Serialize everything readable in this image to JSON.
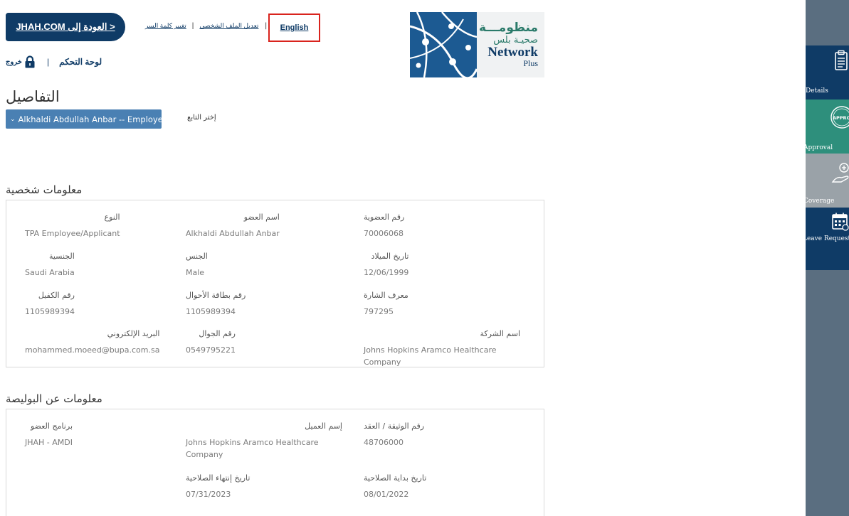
{
  "header": {
    "back_button_label": "< العودة إلى JHAH.COM",
    "change_password_link": "تغيير كلمة السر",
    "edit_profile_link": "تعديل الملف الشخصي",
    "language_link": "English",
    "separator": "|",
    "dashboard_link": "لوحة التحكم",
    "logout_label": "خروج",
    "logo": {
      "arabic_line1": "منظومـــة",
      "arabic_line2": "صحيـة بلس",
      "english_line1": "Network",
      "english_line2": "Plus"
    }
  },
  "page": {
    "title": "التفاصيل",
    "dependent_select_value": "Alkhaldi Abdullah Anbar -- Employee",
    "dependent_label": "إختر التابع"
  },
  "personal_info": {
    "title": "معلومات شخصية",
    "fields": {
      "membership_no": {
        "label": "رقم العضوية",
        "value": "70006068"
      },
      "member_name": {
        "label": "اسم العضو",
        "value": "Alkhaldi Abdullah Anbar"
      },
      "type": {
        "label": "النوع",
        "value": "TPA Employee/Applicant"
      },
      "dob": {
        "label": "تاريخ الميلاد",
        "value": "12/06/1999"
      },
      "gender": {
        "label": "الجنس",
        "value": "Male"
      },
      "nationality": {
        "label": "الجنسية",
        "value": "Saudi Arabia"
      },
      "badge_id": {
        "label": "معرف الشارة",
        "value": "797295"
      },
      "civil_id": {
        "label": "رقم بطاقة الأحوال",
        "value": "1105989394"
      },
      "sponsor_no": {
        "label": "رقم الكفيل",
        "value": "1105989394"
      },
      "company": {
        "label": "اسم الشركة",
        "value": "Johns Hopkins Aramco Healthcare Company"
      },
      "mobile": {
        "label": "رقم الجوال",
        "value": "0549795221"
      },
      "email": {
        "label": "البريد الإلكتروني",
        "value": "mohammed.moeed@bupa.com.sa"
      }
    }
  },
  "policy_info": {
    "title": "معلومات عن البوليصة",
    "fields": {
      "policy_no": {
        "label": "رقم الوثيقة / العقد",
        "value": "48706000"
      },
      "client_name": {
        "label": "إسم العميل",
        "value": "Johns Hopkins Aramco Healthcare Company"
      },
      "program": {
        "label": "برنامج العضو",
        "value": "JHAH - AMDI"
      },
      "start_date": {
        "label": "تاريخ بداية الصلاحية",
        "value": "08/01/2022"
      },
      "end_date": {
        "label": "تاريخ إنتهاء الصلاحية",
        "value": "07/31/2023"
      }
    }
  },
  "sidebar": {
    "items": [
      {
        "label": "Details",
        "icon": "document-icon"
      },
      {
        "label": "Approval",
        "icon": "approval-stamp-icon"
      },
      {
        "label": "Coverage",
        "icon": "coverage-hand-icon"
      },
      {
        "label": "Leave Request",
        "icon": "calendar-icon"
      }
    ]
  },
  "colors": {
    "primary_navy": "#0f3b66",
    "select_blue": "#4a80b3",
    "approval_green": "#2e8f7c",
    "sidebar_gray": "#5a6e80",
    "highlight_red": "#d9231d"
  }
}
